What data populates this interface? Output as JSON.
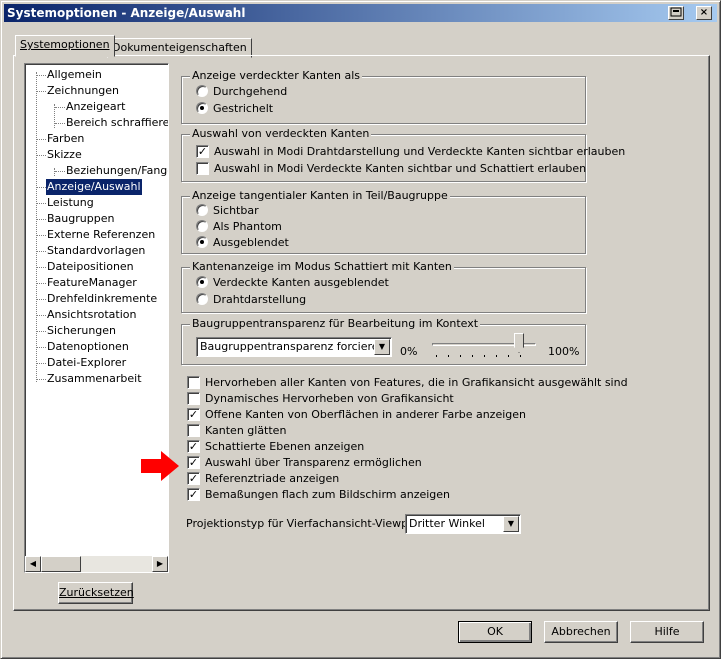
{
  "window": {
    "title": "Systemoptionen - Anzeige/Auswahl",
    "help_glyph": "?",
    "close_glyph": "×"
  },
  "tabs": [
    {
      "label": "Systemoptionen",
      "active": true
    },
    {
      "label": "Dokumenteigenschaften",
      "active": false
    }
  ],
  "tree": {
    "items": [
      {
        "label": "Allgemein",
        "level": 0
      },
      {
        "label": "Zeichnungen",
        "level": 0
      },
      {
        "label": "Anzeigeart",
        "level": 1
      },
      {
        "label": "Bereich schraffieren/",
        "level": 1
      },
      {
        "label": "Farben",
        "level": 0
      },
      {
        "label": "Skizze",
        "level": 0
      },
      {
        "label": "Beziehungen/Fangen",
        "level": 1
      },
      {
        "label": "Anzeige/Auswahl",
        "level": 0,
        "selected": true
      },
      {
        "label": "Leistung",
        "level": 0
      },
      {
        "label": "Baugruppen",
        "level": 0
      },
      {
        "label": "Externe Referenzen",
        "level": 0
      },
      {
        "label": "Standardvorlagen",
        "level": 0
      },
      {
        "label": "Dateipositionen",
        "level": 0
      },
      {
        "label": "FeatureManager",
        "level": 0
      },
      {
        "label": "Drehfeldinkremente",
        "level": 0
      },
      {
        "label": "Ansichtsrotation",
        "level": 0
      },
      {
        "label": "Sicherungen",
        "level": 0
      },
      {
        "label": "Datenoptionen",
        "level": 0
      },
      {
        "label": "Datei-Explorer",
        "level": 0
      },
      {
        "label": "Zusammenarbeit",
        "level": 0
      }
    ],
    "reset_button": "Zurücksetzen"
  },
  "groups": {
    "hidden_edges_display": {
      "label": "Anzeige verdeckter Kanten als",
      "options": [
        {
          "label": "Durchgehend",
          "checked": false
        },
        {
          "label": "Gestrichelt",
          "checked": true
        }
      ]
    },
    "hidden_edges_selection": {
      "label": "Auswahl von verdeckten Kanten",
      "options": [
        {
          "label": "Auswahl in Modi Drahtdarstellung und Verdeckte Kanten sichtbar erlauben",
          "checked": true
        },
        {
          "label": "Auswahl in Modi Verdeckte Kanten sichtbar und Schattiert erlauben",
          "checked": false
        }
      ]
    },
    "tangent_edges": {
      "label": "Anzeige tangentialer Kanten in Teil/Baugruppe",
      "options": [
        {
          "label": "Sichtbar",
          "checked": false
        },
        {
          "label": "Als Phantom",
          "checked": false
        },
        {
          "label": "Ausgeblendet",
          "checked": true
        }
      ]
    },
    "shaded_edges": {
      "label": "Kantenanzeige im Modus Schattiert mit Kanten",
      "options": [
        {
          "label": "Verdeckte Kanten ausgeblendet",
          "checked": true
        },
        {
          "label": "Drahtdarstellung",
          "checked": false
        }
      ]
    },
    "transparency": {
      "label": "Baugruppentransparenz für Bearbeitung im Kontext",
      "select_value": "Baugruppentransparenz forcieren",
      "min_label": "0%",
      "max_label": "100%",
      "slider_value_percent": 87
    }
  },
  "checkboxes": [
    {
      "label": "Hervorheben aller Kanten von Features, die in Grafikansicht ausgewählt sind",
      "checked": false
    },
    {
      "label": "Dynamisches Hervorheben von Grafikansicht",
      "checked": false
    },
    {
      "label": "Offene Kanten von Oberflächen in anderer Farbe anzeigen",
      "checked": true
    },
    {
      "label": "Kanten glätten",
      "checked": false
    },
    {
      "label": "Schattierte Ebenen anzeigen",
      "checked": true
    },
    {
      "label": "Auswahl über Transparenz ermöglichen",
      "checked": true
    },
    {
      "label": "Referenztriade anzeigen",
      "checked": true
    },
    {
      "label": "Bemaßungen flach zum Bildschirm anzeigen",
      "checked": true
    }
  ],
  "projection": {
    "label": "Projektionstyp für Vierfachansicht-Viewport:",
    "value": "Dritter Winkel"
  },
  "annotation": {
    "color": "#ff0000"
  },
  "footer": {
    "ok": "OK",
    "cancel": "Abbrechen",
    "help": "Hilfe"
  }
}
